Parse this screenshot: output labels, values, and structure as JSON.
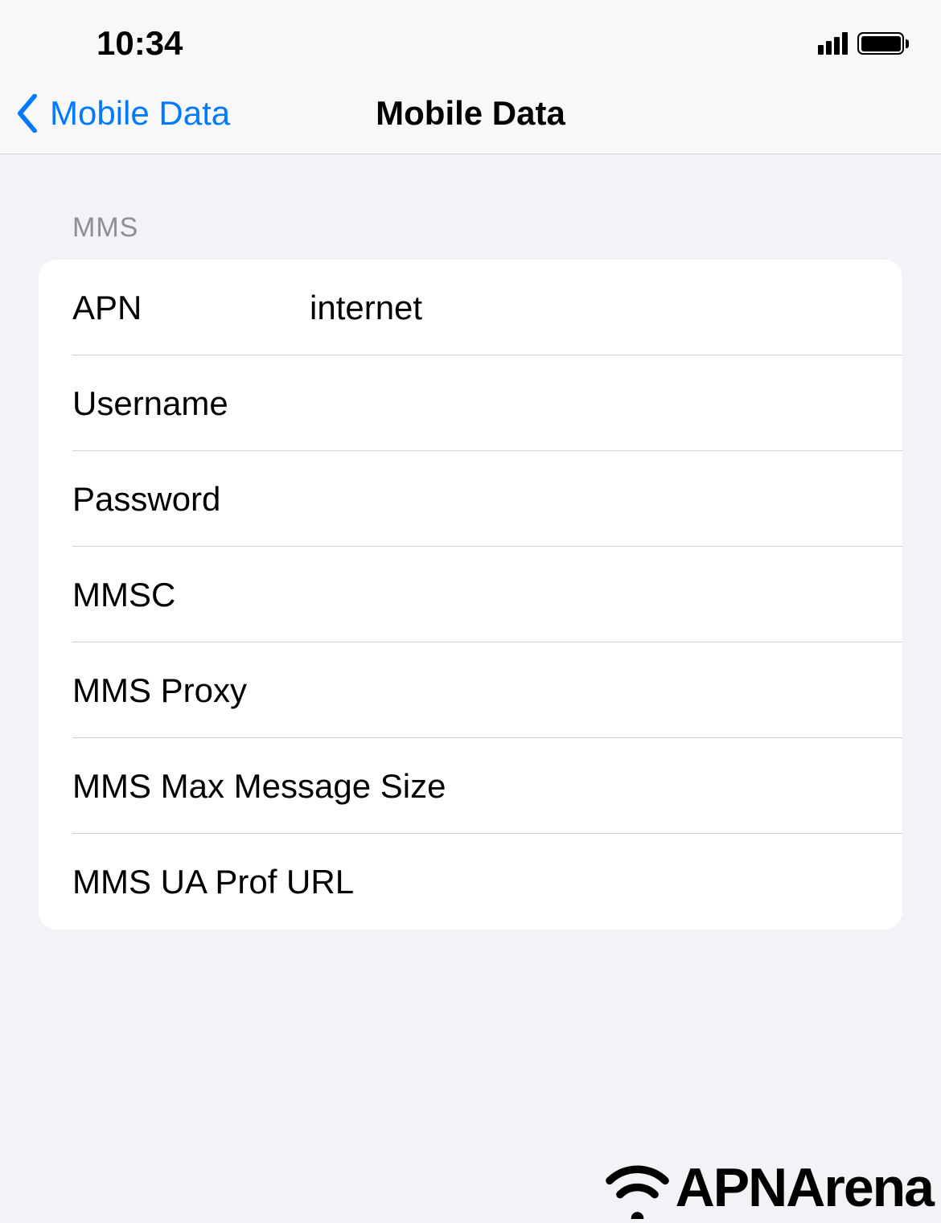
{
  "status_bar": {
    "time": "10:34"
  },
  "nav": {
    "back_label": "Mobile Data",
    "title": "Mobile Data"
  },
  "section": {
    "header": "MMS",
    "rows": {
      "apn": {
        "label": "APN",
        "value": "internet"
      },
      "username": {
        "label": "Username",
        "value": ""
      },
      "password": {
        "label": "Password",
        "value": ""
      },
      "mmsc": {
        "label": "MMSC",
        "value": ""
      },
      "mms_proxy": {
        "label": "MMS Proxy",
        "value": ""
      },
      "mms_max": {
        "label": "MMS Max Message Size",
        "value": ""
      },
      "mms_ua": {
        "label": "MMS UA Prof URL",
        "value": ""
      }
    }
  },
  "watermark": {
    "text": "APNArena"
  },
  "footer": {
    "text": "APNArena"
  }
}
